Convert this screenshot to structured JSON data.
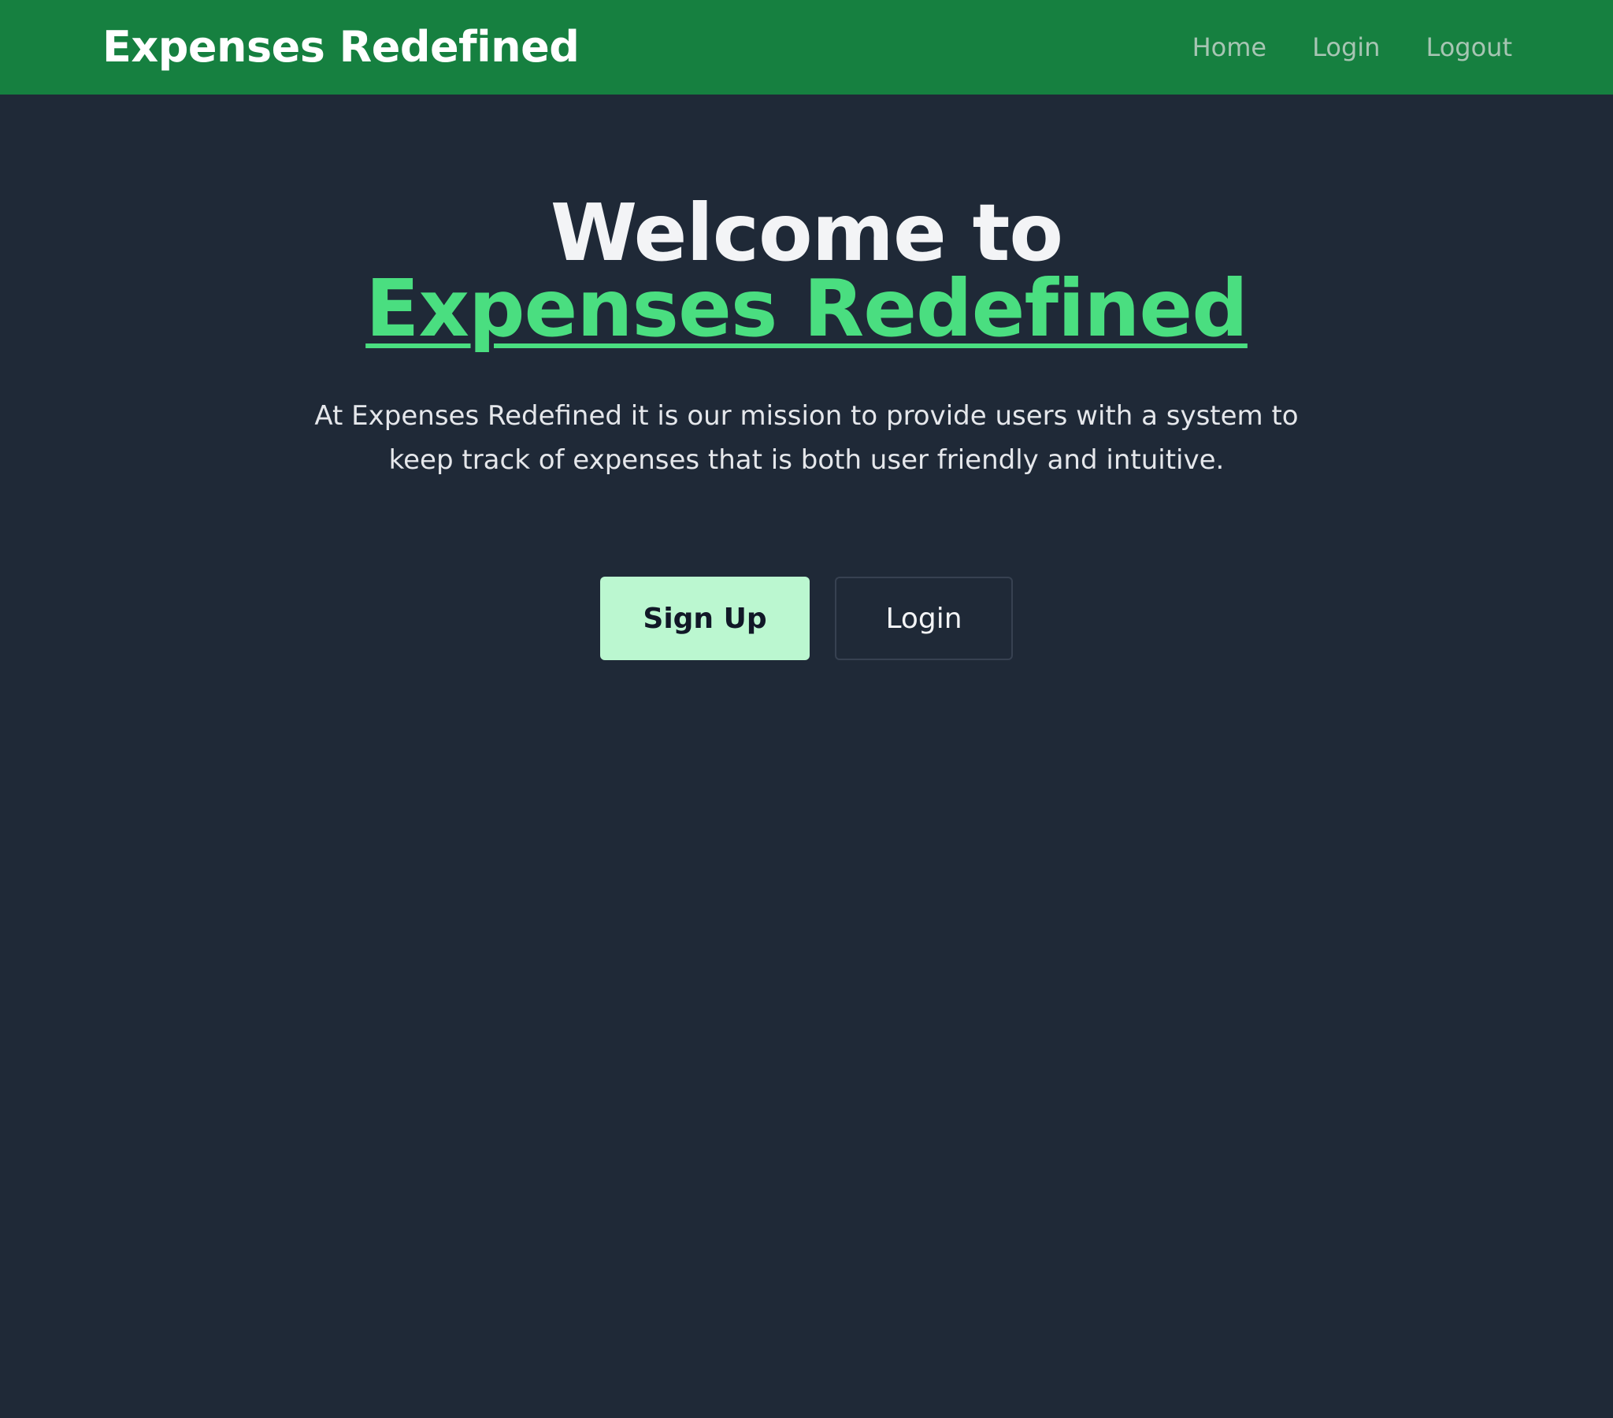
{
  "navbar": {
    "brand": "Expenses Redefined",
    "links": [
      {
        "label": "Home"
      },
      {
        "label": "Login"
      },
      {
        "label": "Logout"
      }
    ]
  },
  "hero": {
    "headline_prefix": "Welcome to",
    "headline_accent": "Expenses Redefined",
    "mission": "At Expenses Redefined it is our mission to provide users with a system to keep track of expenses that is both user friendly and intuitive.",
    "signup_label": "Sign Up",
    "login_label": "Login"
  },
  "colors": {
    "navbar_bg": "#168040",
    "page_bg": "#1f2937",
    "accent": "#4ade80",
    "signup_bg": "#bbf7d0"
  }
}
